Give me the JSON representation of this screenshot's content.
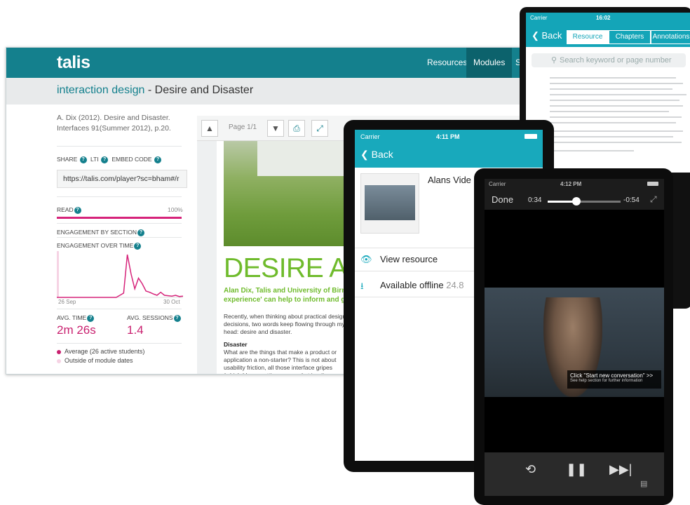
{
  "desktop": {
    "logo": "talis",
    "nav": {
      "resources": "Resources",
      "modules": "Modules",
      "more": "S"
    },
    "title": {
      "crumb": "interaction design",
      "sep": " - ",
      "name": "Desire and Disaster"
    },
    "citation": "A. Dix (2012). Desire and Disaster. Interfaces 91(Summer 2012), p.20.",
    "share": {
      "share": "SHARE",
      "lti": "LTI",
      "embed": "EMBED CODE",
      "url": "https://talis.com/player?sc=bham#/r"
    },
    "read": {
      "label": "READ",
      "value": "100%"
    },
    "engagement": {
      "by_section": "ENGAGEMENT BY SECTION",
      "over_time": "ENGAGEMENT OVER TIME",
      "x_start": "26 Sep",
      "x_end": "30 Oct"
    },
    "stats": {
      "avg_time_label": "AVG. TIME",
      "avg_time": "2m 26s",
      "avg_sessions_label": "AVG. SESSIONS",
      "avg_sessions": "1.4"
    },
    "legend": {
      "average": "Average (26 active students)",
      "outside": "Outside of module dates"
    },
    "viewer": {
      "page": "Page 1/1",
      "heading": "DESIRE A",
      "author_line1": "Alan Dix, Talis and University of Birm",
      "author_line2": "experience' can help to inform and gu",
      "body": "Recently, when thinking about practical design decisions, two words keep flowing through my head: desire and disaster.",
      "subheading": "Disaster",
      "body2": "What are the things that make a product or application a non-starter? This is not about usability friction, all those interface gripes (which I keep getting annoyed at in other"
    }
  },
  "tablet": {
    "status": {
      "carrier": "Carrier",
      "time": "16:02"
    },
    "back": "Back",
    "segments": [
      "Resource",
      "Chapters",
      "Annotations"
    ],
    "search_placeholder": "Search keyword or page number"
  },
  "phone1": {
    "status": {
      "carrier": "Carrier",
      "time": "4:11 PM"
    },
    "back": "Back",
    "title": "Alans Vide",
    "view_resource": "View resource",
    "available_offline": "Available offline",
    "size": "24.8"
  },
  "phone2": {
    "status": {
      "carrier": "Carrier",
      "time": "4:12 PM"
    },
    "done": "Done",
    "elapsed": "0:34",
    "remaining": "-0:54",
    "progress": 0.39,
    "caption": "Click \"Start new conversation\" >>",
    "caption_sub": "See help section for further information"
  },
  "chart_data": {
    "type": "line",
    "title": "",
    "xlabel": "",
    "ylabel": "",
    "x": [
      "26 Sep",
      "30 Oct"
    ],
    "series": [
      {
        "values": [
          0,
          0,
          0,
          0,
          0,
          0,
          0,
          0,
          0,
          0,
          0,
          0,
          0,
          0,
          0,
          0,
          0,
          0.05,
          0.1,
          1.0,
          0.55,
          0.2,
          0.45,
          0.32,
          0.15,
          0.12,
          0.08,
          0.05,
          0.12,
          0.05,
          0.04,
          0.03,
          0.05,
          0.02,
          0.03
        ]
      }
    ],
    "ylim": [
      0,
      1.05
    ],
    "color": "#d6237a"
  }
}
